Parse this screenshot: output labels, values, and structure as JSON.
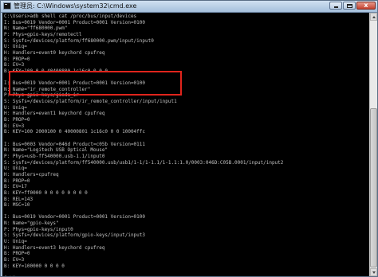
{
  "window": {
    "title": "管理员: C:\\Windows\\system32\\cmd.exe",
    "icon": "console-icon",
    "minimize_icon": "minimize-icon",
    "maximize_icon": "maximize-icon",
    "close_icon": "close-icon",
    "close_glyph": "x"
  },
  "console": {
    "lines": [
      "C:\\Users>adb shell cat /proc/bus/input/devices",
      "I: Bus=0019 Vendor=0001 Product=0001 Version=0100",
      "N: Name=\"ff680000.pwm\"",
      "P: Phys=gpio-keys/remotectl",
      "S: Sysfs=/devices/platform/ff680000.pwm/input/input0",
      "U: Uniq=",
      "H: Handlers=event0 keychord cpufreq",
      "B: PROP=0",
      "B: EV=3",
      "B: KEY=100 0 0 40400800 1c16c0 0 0 0",
      "",
      "I: Bus=0019 Vendor=0001 Product=0001 Version=0100",
      "N: Name=\"ir_remote_controller\"",
      "P: Phys=gpio-keys/giada_ir",
      "S: Sysfs=/devices/platform/ir_remote_controller/input/input1",
      "U: Uniq=",
      "H: Handlers=event1 keychord cpufreq",
      "B: PROP=0",
      "B: EV=3",
      "B: KEY=100 2000100 0 40000801 1c16c0 0 0 10004ffc",
      "",
      "I: Bus=0003 Vendor=046d Product=c05b Version=0111",
      "N: Name=\"Logitech USB Optical Mouse\"",
      "P: Phys=usb-ff540000.usb-1.1/input0",
      "S: Sysfs=/devices/platform/ff540000.usb/usb1/1-1/1-1.1/1-1.1:1.0/0003:046D:C05B.0001/input/input2",
      "U: Uniq=",
      "H: Handlers=cpufreq",
      "B: PROP=0",
      "B: EV=17",
      "B: KEY=ff0000 0 0 0 0 0 0 0 0",
      "B: REL=143",
      "B: MSC=10",
      "",
      "I: Bus=0019 Vendor=0001 Product=0001 Version=0100",
      "N: Name=\"gpio-keys\"",
      "P: Phys=gpio-keys/input0",
      "S: Sysfs=/devices/platform/gpio-keys/input/input3",
      "U: Uniq=",
      "H: Handlers=event3 keychord cpufreq",
      "B: PROP=0",
      "B: EV=3",
      "B: KEY=100000 0 0 0 0",
      "",
      "C:\\Users>"
    ]
  }
}
